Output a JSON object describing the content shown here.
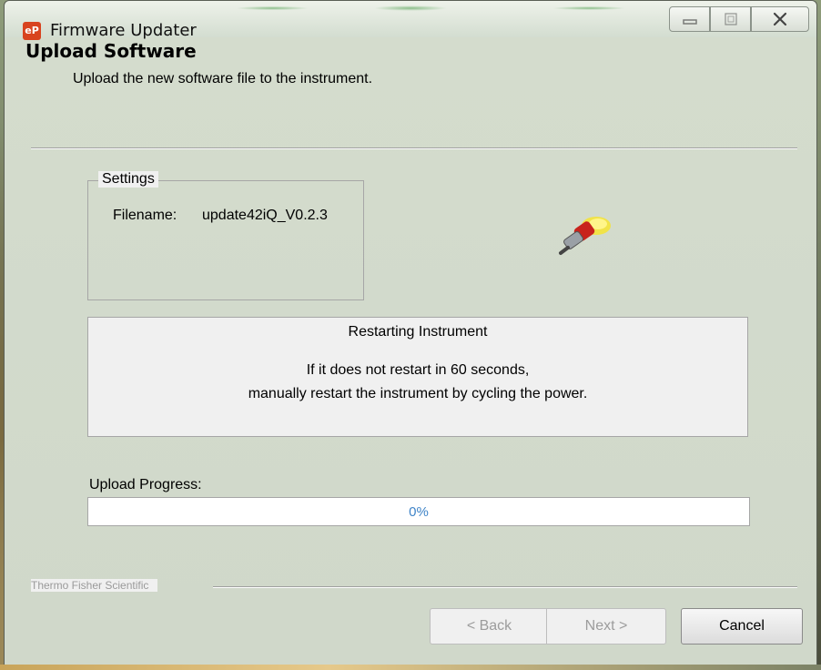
{
  "window": {
    "title": "Firmware Updater",
    "icon_label": "eP"
  },
  "header": {
    "heading": "Upload Software",
    "subtitle": "Upload the new software file to the instrument."
  },
  "settings": {
    "legend": "Settings",
    "filename_label": "Filename:",
    "filename_value": "update42iQ_V0.2.3"
  },
  "status": {
    "title": "Restarting Instrument",
    "line1": "If it does not restart in 60 seconds,",
    "line2": "manually restart the instrument by cycling the power."
  },
  "progress": {
    "label": "Upload Progress:",
    "text": "0%",
    "value": 0
  },
  "footer": {
    "brand": "Thermo Fisher Scientific",
    "back_label": "< Back",
    "next_label": "Next >",
    "cancel_label": "Cancel"
  },
  "colors": {
    "progress_text": "#3f84c8",
    "app_icon": "#d8431f"
  },
  "icons": {
    "app": "app-icon",
    "plug": "plug-icon",
    "minimize": "minimize-icon",
    "maximize": "maximize-icon",
    "close": "close-icon"
  }
}
